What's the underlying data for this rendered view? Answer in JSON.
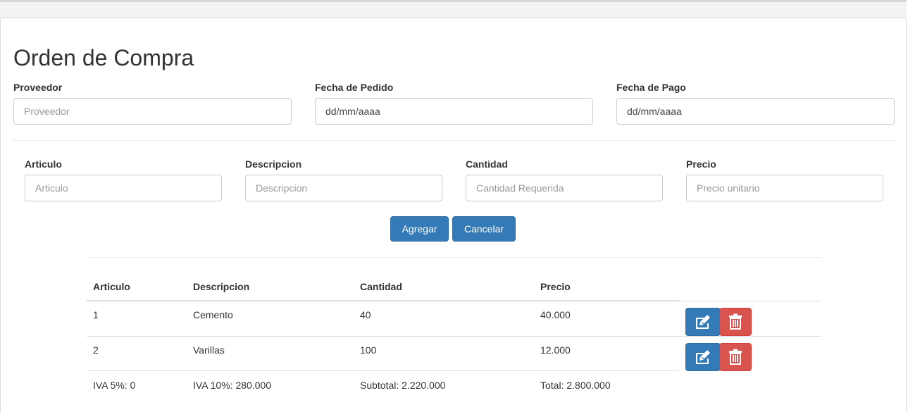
{
  "page": {
    "title": "Orden de Compra"
  },
  "header_form": {
    "proveedor": {
      "label": "Proveedor",
      "placeholder": "Proveedor"
    },
    "fecha_pedido": {
      "label": "Fecha de Pedido",
      "value": "dd/mm/aaaa"
    },
    "fecha_pago": {
      "label": "Fecha de Pago",
      "value": "dd/mm/aaaa"
    }
  },
  "item_form": {
    "articulo": {
      "label": "Articulo",
      "placeholder": "Articulo"
    },
    "descripcion": {
      "label": "Descripcion",
      "placeholder": "Descripcion"
    },
    "cantidad": {
      "label": "Cantidad",
      "placeholder": "Cantidad Requerida"
    },
    "precio": {
      "label": "Precio",
      "placeholder": "Precio unitario"
    },
    "add_label": "Agregar",
    "cancel_label": "Cancelar"
  },
  "table": {
    "headers": [
      "Articulo",
      "Descripcion",
      "Cantidad",
      "Precio"
    ],
    "rows": [
      {
        "articulo": "1",
        "descripcion": "Cemento",
        "cantidad": "40",
        "precio": "40.000"
      },
      {
        "articulo": "2",
        "descripcion": "Varillas",
        "cantidad": "100",
        "precio": "12.000"
      }
    ],
    "row_actions": {
      "edit_icon": "edit-icon",
      "delete_icon": "trash-icon"
    },
    "totals": {
      "iva5": "IVA 5%: 0",
      "iva10": "IVA 10%: 280.000",
      "subtotal": "Subtotal: 2.220.000",
      "total": "Total: 2.800.000"
    }
  },
  "colors": {
    "primary": "#337ab7",
    "danger": "#d9534f",
    "text": "#333333",
    "border": "#cccccc"
  }
}
